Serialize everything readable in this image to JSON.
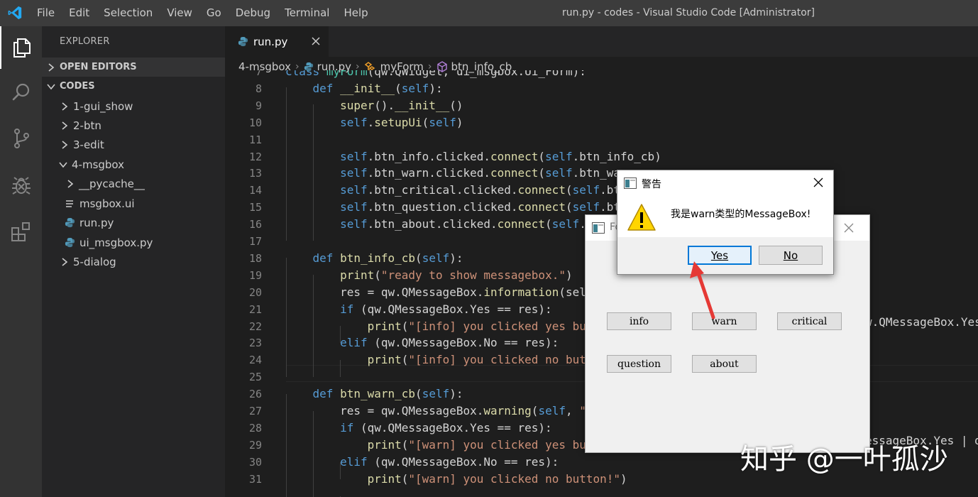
{
  "titlebar": {
    "menu": [
      "File",
      "Edit",
      "Selection",
      "View",
      "Go",
      "Debug",
      "Terminal",
      "Help"
    ],
    "title": "run.py - codes - Visual Studio Code [Administrator]"
  },
  "activitybar": [
    "explorer-icon",
    "search-icon",
    "source-control-icon",
    "debug-icon",
    "extensions-icon"
  ],
  "sidebar": {
    "title": "EXPLORER",
    "open_editors": "OPEN EDITORS",
    "root": "CODES",
    "items": [
      {
        "label": "1-gui_show",
        "type": "folder",
        "expanded": false
      },
      {
        "label": "2-btn",
        "type": "folder",
        "expanded": false
      },
      {
        "label": "3-edit",
        "type": "folder",
        "expanded": false
      },
      {
        "label": "4-msgbox",
        "type": "folder",
        "expanded": true
      },
      {
        "label": "__pycache__",
        "type": "folder",
        "expanded": false
      },
      {
        "label": "msgbox.ui",
        "type": "file"
      },
      {
        "label": "run.py",
        "type": "python"
      },
      {
        "label": "ui_msgbox.py",
        "type": "python"
      },
      {
        "label": "5-dialog",
        "type": "folder",
        "expanded": false
      }
    ]
  },
  "editor": {
    "tab": "run.py",
    "breadcrumb": [
      "4-msgbox",
      "run.py",
      "myForm",
      "btn_info_cb"
    ],
    "lines": [
      {
        "n": "7",
        "text": "class myForm(qw.QWidget, ui_msgbox.Ui_Form):"
      },
      {
        "n": "8",
        "text": "    def __init__(self):"
      },
      {
        "n": "9",
        "text": "        super().__init__()"
      },
      {
        "n": "10",
        "text": "        self.setupUi(self)"
      },
      {
        "n": "11",
        "text": ""
      },
      {
        "n": "12",
        "text": "        self.btn_info.clicked.connect(self.btn_info_cb)"
      },
      {
        "n": "13",
        "text": "        self.btn_warn.clicked.connect(self.btn_wa"
      },
      {
        "n": "14",
        "text": "        self.btn_critical.clicked.connect(self.bt"
      },
      {
        "n": "15",
        "text": "        self.btn_question.clicked.connect(self.bt"
      },
      {
        "n": "16",
        "text": "        self.btn_about.clicked.connect(self."
      },
      {
        "n": "17",
        "text": ""
      },
      {
        "n": "18",
        "text": "    def btn_info_cb(self):"
      },
      {
        "n": "19",
        "text": "        print(\"ready to show messagebox.\")"
      },
      {
        "n": "20",
        "text": "        res = qw.QMessageBox.information(sel"
      },
      {
        "n": "21",
        "text": "        if (qw.QMessageBox.Yes == res):"
      },
      {
        "n": "22",
        "text": "            print(\"[info] you clicked yes bu"
      },
      {
        "n": "23",
        "text": "        elif (qw.QMessageBox.No == res):"
      },
      {
        "n": "24",
        "text": "            print(\"[info] you clicked no but"
      },
      {
        "n": "25",
        "text": ""
      },
      {
        "n": "26",
        "text": "    def btn_warn_cb(self):"
      },
      {
        "n": "27",
        "text": "        res = qw.QMessageBox.warning(self, \""
      },
      {
        "n": "28",
        "text": "        if (qw.QMessageBox.Yes == res):"
      },
      {
        "n": "29",
        "text": "            print(\"[warn] you clicked yes bu"
      },
      {
        "n": "30",
        "text": "        elif (qw.QMessageBox.No == res):"
      },
      {
        "n": "31",
        "text": "            print(\"[warn] you clicked no button!\")"
      }
    ],
    "overflow_right_20": "w.QMessageBox.Yes",
    "overflow_right_27": "essageBox.Yes | d"
  },
  "form_window": {
    "title": "Fo",
    "buttons": [
      "info",
      "warn",
      "critical",
      "question",
      "about"
    ]
  },
  "message_box": {
    "title": "警告",
    "text": "我是warn类型的MessageBox!",
    "yes": "Yes",
    "no": "No"
  },
  "watermark": "知乎 @一叶孤沙",
  "colors": {
    "titlebar": "#3c3c3c",
    "activitybar": "#333333",
    "sidebar": "#252526",
    "editor": "#1e1e1e",
    "keyword": "#569cd6",
    "function": "#dcdcaa",
    "string": "#ce9178",
    "class": "#4ec9b0",
    "annotation_arrow": "#e53935"
  }
}
